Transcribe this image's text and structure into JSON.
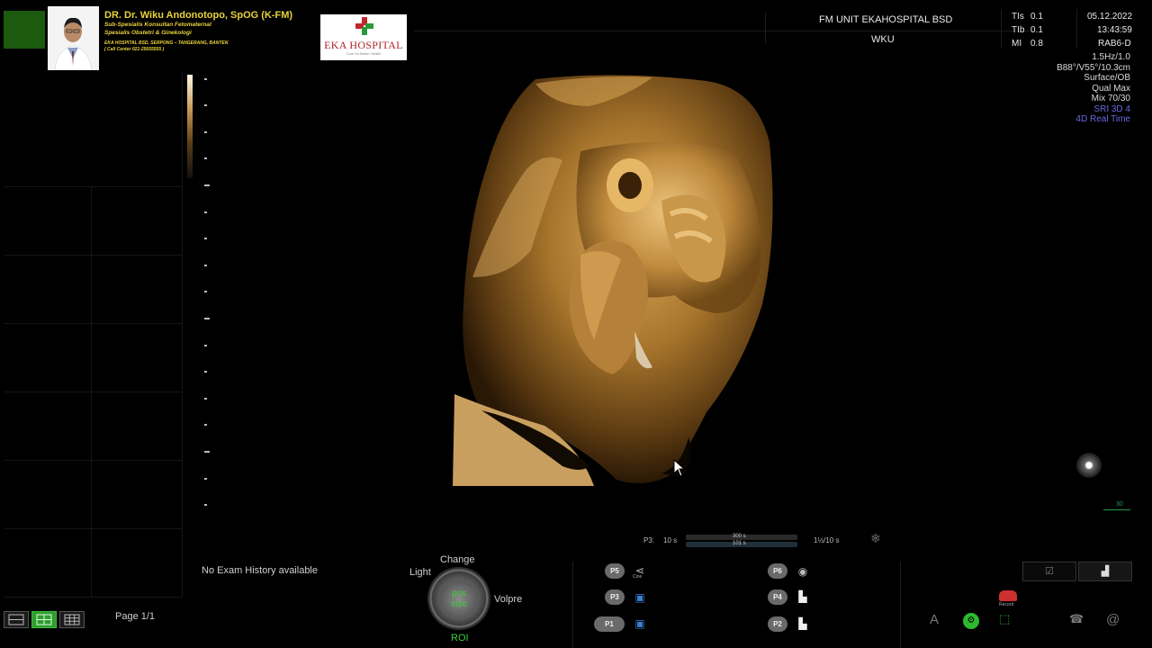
{
  "header": {
    "doctor_name": "DR. Dr. Wiku Andonotopo, SpOG (K-FM)",
    "doctor_line1": "Sub-Spesialis Konsultan Fetomaternal",
    "doctor_line2": "Spesialis Obstetri & Ginekologi",
    "doctor_addr1": "EKA HOSPITAL BSD, SERPONG – TANGERANG, BANTEN",
    "doctor_addr2": "( Call Center 021-25655555 )",
    "hospital_name": "EKA HOSPITAL",
    "hospital_tagline": "Care for Better Health",
    "unit": "FM UNIT EKAHOSPITAL BSD",
    "operator": "WKU"
  },
  "indices": {
    "tis_label": "TIs",
    "tis_value": "0.1",
    "tib_label": "TIb",
    "tib_value": "0.1",
    "mi_label": "MI",
    "mi_value": "0.8"
  },
  "datetime": {
    "date": "05.12.2022",
    "time": "13:43:59",
    "probe": "RAB6-D"
  },
  "acquisition": {
    "freq": "1.5Hz/1.0",
    "angles": "B88°/V55°/10.3cm",
    "render_mode": "Surface/OB",
    "quality": "Qual Max",
    "mix": "Mix 70/30",
    "sri": "SRI 3D 4",
    "mode": "4D Real Time"
  },
  "cine": {
    "p3_label": "P3:",
    "p3_value": "10 s",
    "bar_top": "300 s",
    "bar_bottom": "101 s",
    "ratio": "1½/10 s",
    "mini_mark": "30"
  },
  "bottom": {
    "no_exam": "No Exam History available",
    "page": "Page 1/1",
    "knob_top": "Change",
    "knob_left": "Light",
    "knob_right": "Volpre",
    "knob_bottom": "ROI",
    "knob_center_1": "pos",
    "knob_center_2": "size",
    "presets": [
      "P5",
      "P3",
      "P1",
      "P6",
      "P4",
      "P2"
    ],
    "cine_icon_label": "Cine",
    "key_a": "A",
    "key_at": "@",
    "record_label": "Record"
  },
  "colors": {
    "accent_green": "#2dbb2d",
    "name_yellow": "#e8d23a",
    "mode_blue": "#6a6adf",
    "hospital_red": "#b0232a"
  }
}
